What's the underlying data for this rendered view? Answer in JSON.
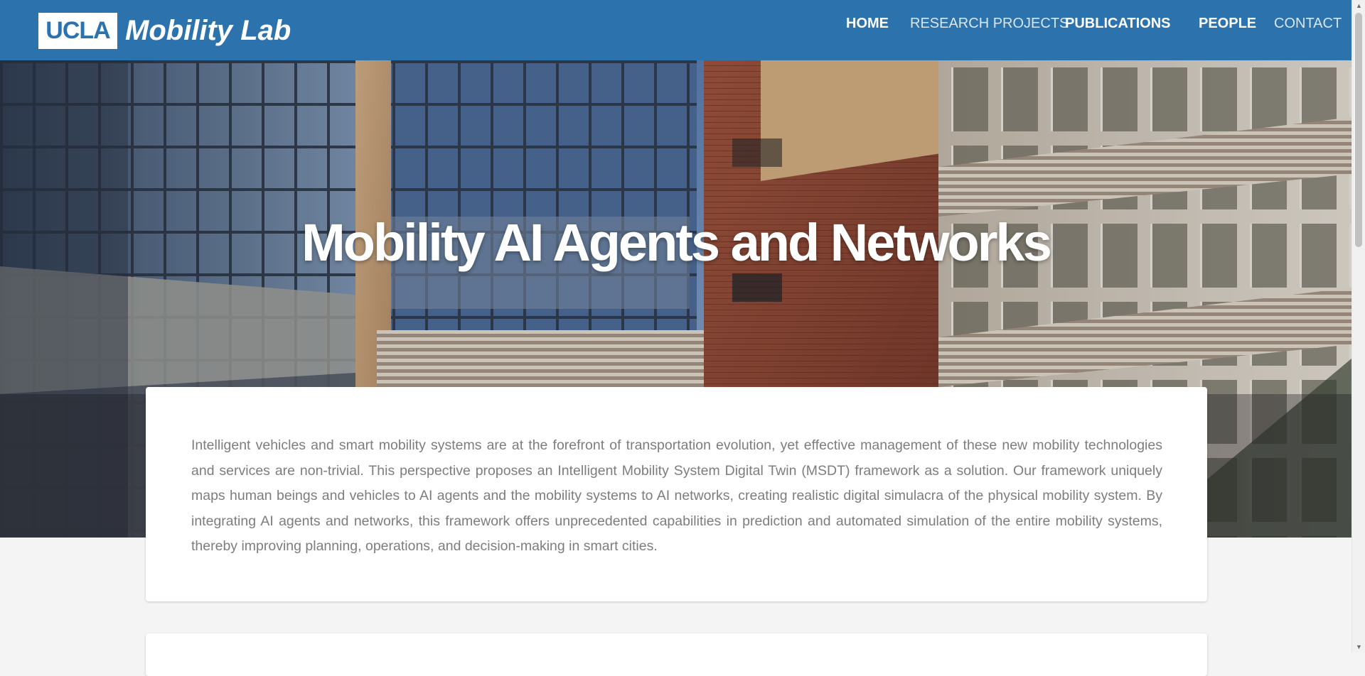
{
  "brand": {
    "box_text": "UCLA",
    "name": "Mobility Lab"
  },
  "nav": {
    "items": [
      {
        "label": "HOME"
      },
      {
        "label": "RESEARCH PROJECTS"
      },
      {
        "label": "PUBLICATIONS"
      },
      {
        "label": "PEOPLE"
      },
      {
        "label": "CONTACT"
      }
    ]
  },
  "hero": {
    "title": "Mobility AI Agents and Networks"
  },
  "article": {
    "body": "Intelligent vehicles and smart mobility systems are at the forefront of transportation evolution, yet effective management of these new mobility technologies and services are non-trivial. This perspective proposes an Intelligent Mobility System Digital Twin (MSDT) framework as a solution. Our framework uniquely maps human beings and vehicles to AI agents and the mobility systems to AI networks, creating realistic digital simulacra of the physical mobility system. By integrating AI agents and networks, this framework offers unprecedented capabilities in prediction and automated simulation of the entire mobility systems, thereby improving planning, operations, and decision-making in smart cities."
  },
  "colors": {
    "navbar": "#2c72ad",
    "body_text": "#7d7d7d",
    "page_bg": "#f4f4f4"
  },
  "icons": {
    "scroll_up": "up-arrow",
    "scroll_down": "down-arrow"
  }
}
